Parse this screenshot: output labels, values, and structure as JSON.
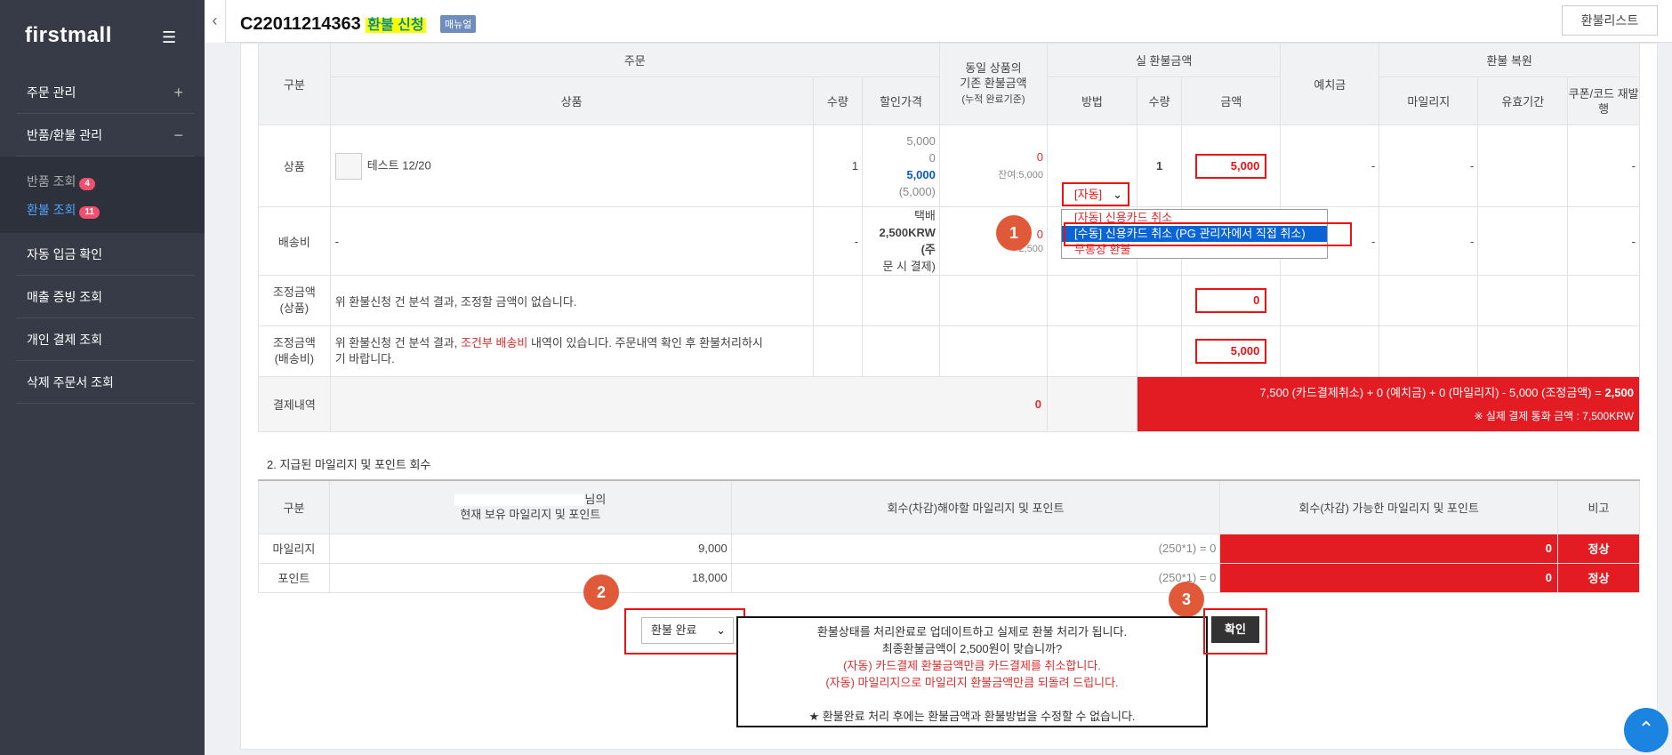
{
  "sidebar": {
    "logo": "firstmall",
    "items": [
      {
        "label": "주문 관리",
        "toggle": "+"
      },
      {
        "label": "반품/환불 관리",
        "toggle": "−"
      },
      {
        "label": "자동 입금 확인"
      },
      {
        "label": "매출 증빙 조회"
      },
      {
        "label": "개인 결제 조회"
      },
      {
        "label": "삭제 주문서 조회"
      }
    ],
    "sub_items": [
      {
        "label": "반품 조회",
        "badge": "4"
      },
      {
        "label": "환불 조회",
        "badge": "11"
      }
    ]
  },
  "header": {
    "order_no": "C22011214363",
    "status": "환불 신청",
    "manual": "매뉴얼",
    "refund_list": "환불리스트"
  },
  "table1": {
    "h_gubun": "구분",
    "h_order": "주문",
    "h_product": "상품",
    "h_qty": "수량",
    "h_disc": "할인가격",
    "h_same1": "동일 상품의",
    "h_same2": "기존 환불금액",
    "h_same3": "(누적 완료기준)",
    "h_actual": "실 환불금액",
    "h_method": "방법",
    "h_qty2": "수량",
    "h_amount": "금액",
    "h_deposit": "예치금",
    "h_restore": "환불 복원",
    "h_mileage": "마일리지",
    "h_valid": "유효기간",
    "h_coupon": "쿠폰/코드 재발행",
    "row_product": {
      "label": "상품",
      "name": "테스트 12/20",
      "qty": "1",
      "p1": "5,000",
      "p2": "0",
      "p3": "5,000",
      "p4": "(5,000)",
      "prev": "0",
      "remain": "잔여:5,000",
      "method": "[자동]",
      "qty2": "1",
      "amount": "5,000",
      "dash": "-"
    },
    "row_ship": {
      "label": "배송비",
      "dash": "-",
      "ship1": "택배",
      "ship2": "2,500KRW (주",
      "ship3": "문 시 결제)",
      "prev": "0",
      "remain": "2,500"
    },
    "row_adj1": {
      "label": "조정금액",
      "label2": "(상품)",
      "text": "위 환불신청 건 분석 결과, 조정할 금액이 없습니다.",
      "amount": "0"
    },
    "row_adj2": {
      "label": "조정금액",
      "label2": "(배송비)",
      "text1": "위 환불신청 건 분석 결과, ",
      "text_red": "조건부 배송비",
      "text2": " 내역이 있습니다. 주문내역 확인 후 환불처리하시",
      "text3": "기 바랍니다.",
      "amount": "5,000"
    },
    "row_pay": {
      "label": "결제내역",
      "value": "0",
      "summary": "7,500 (카드결제취소) + 0 (예치금) + 0 (마일리지) - 5,000 (조정금액) = ",
      "summary_total": "2,500",
      "note": "※ 실제 결제 통화 금액 : 7,500KRW"
    }
  },
  "dropdown": {
    "options": [
      "[자동] 신용카드 취소",
      "[수동] 신용카드 취소 (PG 관리자에서 직접 취소)",
      "무통장 환불"
    ]
  },
  "section2": {
    "title": "2. 지급된 마일리지 및 포인트 회수",
    "h_gubun": "구분",
    "h_hold_suffix": "님의",
    "h_hold2": "현재 보유 마일리지 및 포인트",
    "h_recover": "회수(차감)해야할 마일리지 및 포인트",
    "h_possible": "회수(차감) 가능한 마일리지 및 포인트",
    "h_note": "비고",
    "rows": [
      {
        "label": "마일리지",
        "hold": "9,000",
        "formula": "(250*1) = 0",
        "possible": "0",
        "note": "정상"
      },
      {
        "label": "포인트",
        "hold": "18,000",
        "formula": "(250*1) = 0",
        "possible": "0",
        "note": "정상"
      }
    ]
  },
  "footer": {
    "status_select": "환불 완료",
    "ok": "확인",
    "msg1": "환불상태를 처리완료로 업데이트하고 실제로 환불 처리가 됩니다.",
    "msg2": "최종환불금액이 2,500원이 맞습니까?",
    "msg3": "(자동) 카드결제 환불금액만큼 카드결제를 취소합니다.",
    "msg4": "(자동) 마일리지으로 마일리지 환불금액만큼 되돌려 드립니다.",
    "msg5": "★ 환불완료 처리 후에는 환불금액과 환불방법을 수정할 수 없습니다."
  },
  "annotations": {
    "n1": "1",
    "n2": "2",
    "n3": "3"
  }
}
